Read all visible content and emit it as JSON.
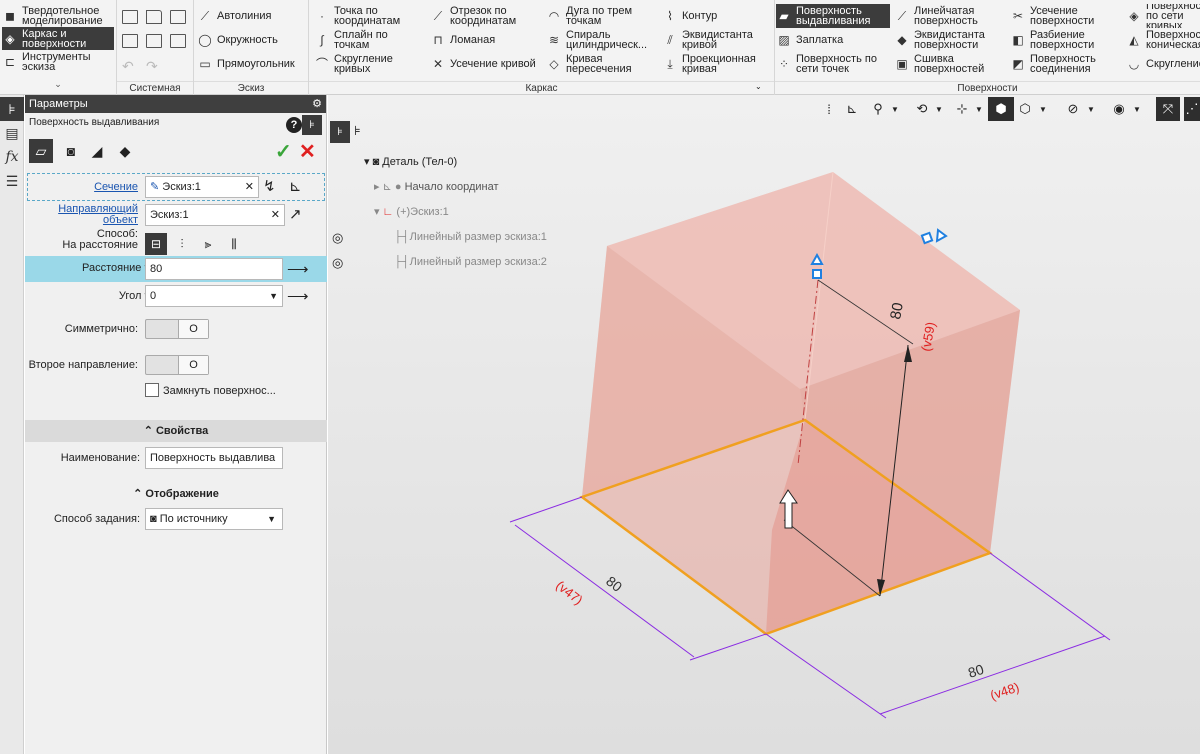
{
  "ribbon": {
    "modes": [
      {
        "label": "Твердотельное моделирование",
        "icon": "solid-modeling-icon"
      },
      {
        "label": "Каркас и поверхности",
        "icon": "wireframe-surface-icon",
        "selected": true
      },
      {
        "label": "Инструменты эскиза",
        "icon": "sketch-tools-icon"
      }
    ],
    "groups": {
      "system": "Системная",
      "sketch": "Эскиз",
      "frame": "Каркас",
      "surfaces": "Поверхности"
    },
    "sketch_tools": [
      "Автолиния",
      "Окружность",
      "Прямоугольник"
    ],
    "frame_col1": [
      "Точка по координатам",
      "Сплайн по точкам",
      "Скругление кривых"
    ],
    "frame_col2": [
      "Отрезок по координатам",
      "Ломаная",
      "Усечение кривой"
    ],
    "frame_col3": [
      "Дуга по трем точкам",
      "Спираль цилиндрическ...",
      "Кривая пересечения"
    ],
    "frame_col4": [
      "Контур",
      "Эквидистанта кривой",
      "Проекционная кривая"
    ],
    "surf_col1": [
      "Поверхность выдавливания",
      "Заплатка",
      "Поверхность по сети точек"
    ],
    "surf_col2": [
      "Линейчатая поверхность",
      "Эквидистанта поверхности",
      "Сшивка поверхностей"
    ],
    "surf_col3": [
      "Усечение поверхности",
      "Разбиение поверхности",
      "Поверхность соединения"
    ],
    "surf_col4": [
      "Поверхность по сети кривых",
      "Поверхность коническая",
      "Скругление"
    ]
  },
  "panel": {
    "header": "Параметры",
    "title": "Поверхность выдавливания",
    "fields": {
      "section_label": "Сечение",
      "section_value": "Эскиз:1",
      "guide_label": "Направляющий объект",
      "guide_value": "Эскиз:1",
      "method_label": "Способ:",
      "method_value": "На расстояние",
      "distance_label": "Расстояние",
      "distance_value": "80",
      "angle_label": "Угол",
      "angle_value": "0",
      "symmetric_label": "Симметрично:",
      "second_dir_label": "Второе направление:",
      "close_label": "Замкнуть поверхнос..."
    },
    "properties_section": "Свойства",
    "name_label": "Наименование:",
    "name_value": "Поверхность выдавлива",
    "display_section": "Отображение",
    "spec_label": "Способ задания:",
    "spec_value": "По источнику",
    "toggle_knob": "O"
  },
  "tree": {
    "root": "Деталь (Тел-0)",
    "origin": "Начало координат",
    "sketch": "Эскиз:1",
    "dim1": "Линейный размер эскиза:1",
    "dim2": "Линейный размер эскиза:2"
  },
  "model": {
    "dim_height": "80",
    "var_height": "(v59)",
    "dim_left": "80",
    "var_left": "(v47)",
    "dim_right": "80",
    "var_right": "(v48)"
  },
  "colors": {
    "accent": "#e8a020",
    "dim_line": "#8a2be2",
    "var_text": "#e02020",
    "surface": "#e89a8a"
  }
}
